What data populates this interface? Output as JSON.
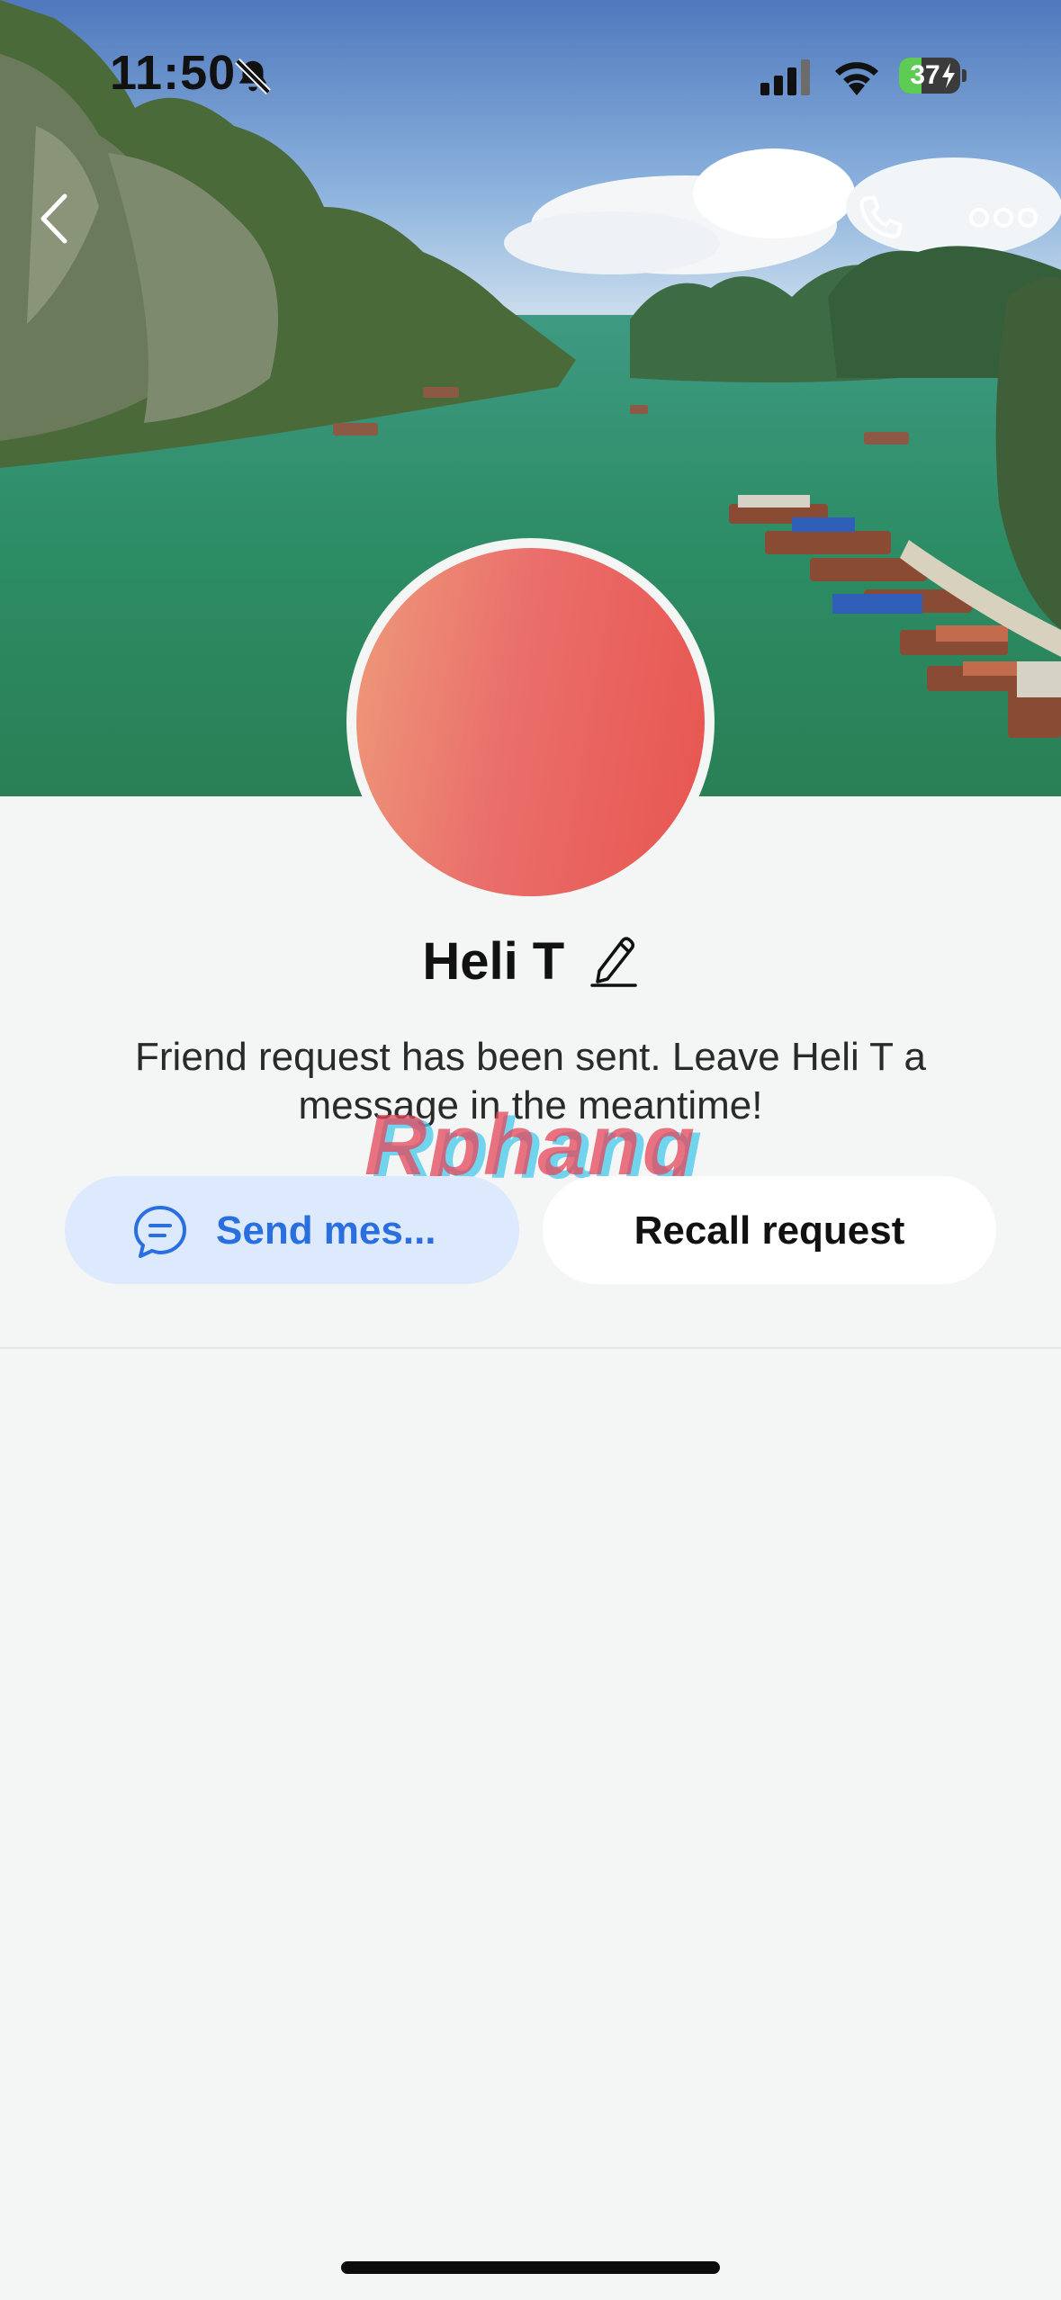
{
  "status_bar": {
    "time": "11:50",
    "battery": "37",
    "battery_level": 0.37,
    "icons": [
      "bell-off-icon",
      "cellular-signal-icon",
      "wifi-icon",
      "battery-icon"
    ]
  },
  "header": {
    "back_icon": "chevron-left-icon",
    "call_icon": "phone-icon",
    "more_icon": "more-horizontal-icon",
    "cover_photo": "landscape bay with limestone islands and boats"
  },
  "profile": {
    "name": "Heli T",
    "edit_icon": "pencil-icon",
    "avatar_colors": [
      "#ee9a7a",
      "#e8554f"
    ],
    "friend_request_message": "Friend request has been sent. Leave Heli T a message in the meantime!"
  },
  "watermark": "Rphang",
  "actions": {
    "send_message_label": "Send mes...",
    "send_message_icon": "chat-bubble-icon",
    "recall_request_label": "Recall request"
  },
  "colors": {
    "accent": "#2a6fe0",
    "send_bg": "#dde9fd",
    "page_bg": "#f4f5f5"
  }
}
